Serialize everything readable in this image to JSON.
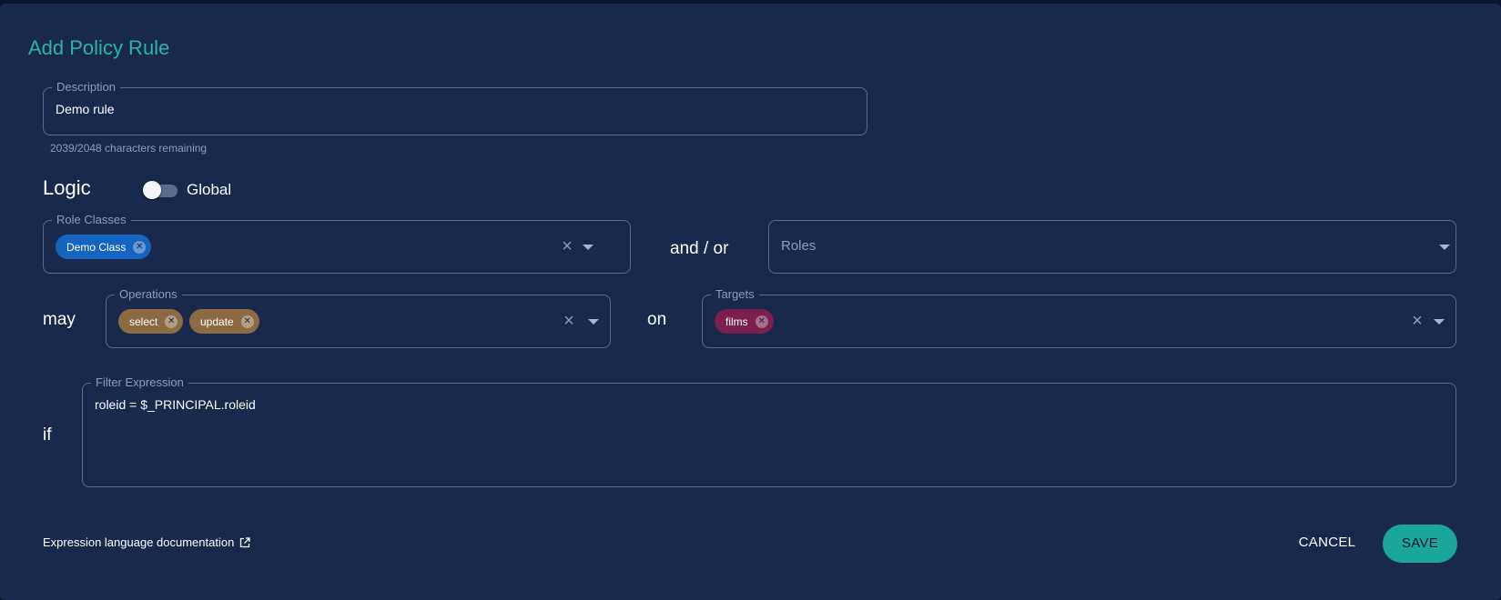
{
  "dialog": {
    "title": "Add Policy Rule"
  },
  "description": {
    "label": "Description",
    "value": "Demo rule",
    "helper": "2039/2048 characters remaining"
  },
  "logic": {
    "heading": "Logic",
    "global_toggle": {
      "label": "Global",
      "checked": false
    }
  },
  "role_classes": {
    "label": "Role Classes",
    "chips": [
      "Demo Class"
    ]
  },
  "connector_and_or": "and / or",
  "roles": {
    "placeholder": "Roles"
  },
  "word_may": "may",
  "operations": {
    "label": "Operations",
    "chips": [
      "select",
      "update"
    ]
  },
  "word_on": "on",
  "targets": {
    "label": "Targets",
    "chips": [
      "films"
    ]
  },
  "word_if": "if",
  "filter_expression": {
    "label": "Filter Expression",
    "value": "roleid = $_PRINCIPAL.roleid"
  },
  "footer": {
    "doc_link": "Expression language documentation",
    "cancel": "CANCEL",
    "save": "SAVE"
  },
  "colors": {
    "background": "#19294d",
    "accent": "#1aa69a",
    "chip_role_class": "#1565c0",
    "chip_operation": "#8c6a42",
    "chip_target": "#7a1f4e"
  },
  "icons": [
    "chip-remove-icon",
    "clear-icon",
    "caret-down-icon",
    "external-link-icon"
  ]
}
